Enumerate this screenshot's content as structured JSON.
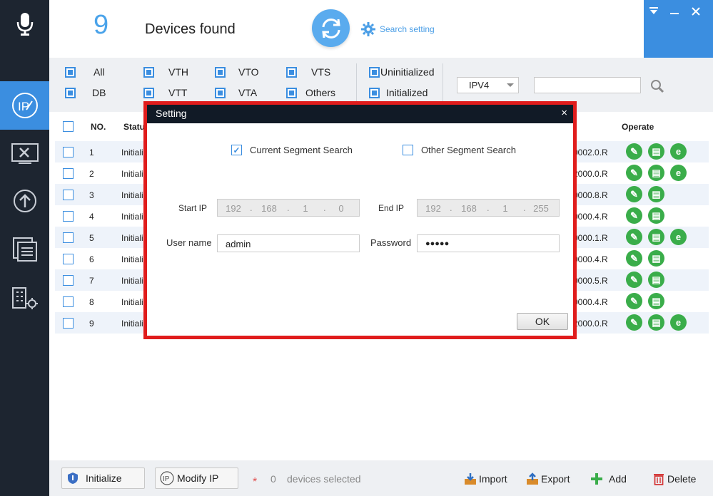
{
  "header": {
    "device_count": "9",
    "devices_found_label": "Devices found",
    "search_setting_label": "Search setting"
  },
  "filters": {
    "row1": [
      "All",
      "VTH",
      "VTO",
      "VTS"
    ],
    "row2": [
      "DB",
      "VTT",
      "VTA",
      "Others"
    ],
    "uninitialized": "Uninitialized",
    "initialized": "Initialized",
    "ip_version": "IPV4",
    "search_value": ""
  },
  "table": {
    "columns": {
      "no": "NO.",
      "status": "Statu",
      "operate": "Operate"
    },
    "rows": [
      {
        "no": "1",
        "status": "Initiali",
        "version": "0002.0.R",
        "ops": 3
      },
      {
        "no": "2",
        "status": "Initiali",
        "version": "2000.0.R",
        "ops": 3
      },
      {
        "no": "3",
        "status": "Initiali",
        "version": "0000.8.R",
        "ops": 2
      },
      {
        "no": "4",
        "status": "Initiali",
        "version": "0000.4.R",
        "ops": 2
      },
      {
        "no": "5",
        "status": "Initiali",
        "version": "0000.1.R",
        "ops": 3
      },
      {
        "no": "6",
        "status": "Initiali",
        "version": "0000.4.R",
        "ops": 2
      },
      {
        "no": "7",
        "status": "Initiali",
        "version": "0000.5.R",
        "ops": 2
      },
      {
        "no": "8",
        "status": "Initiali",
        "version": "0000.4.R",
        "ops": 2
      },
      {
        "no": "9",
        "status": "Initiali",
        "version": "2000.0.R",
        "ops": 3
      }
    ]
  },
  "dialog": {
    "title": "Setting",
    "close": "×",
    "current_segment": "Current Segment Search",
    "other_segment": "Other Segment Search",
    "start_ip_label": "Start IP",
    "start_ip": [
      "192",
      "168",
      "1",
      "0"
    ],
    "end_ip_label": "End IP",
    "end_ip": [
      "192",
      "168",
      "1",
      "255"
    ],
    "username_label": "User name",
    "username": "admin",
    "password_label": "Password",
    "password": "●●●●●",
    "ok": "OK"
  },
  "footer": {
    "initialize": "Initialize",
    "modify_ip": "Modify IP",
    "asterisk": "*",
    "selected_count": "0",
    "selected_label": "devices selected",
    "import": "Import",
    "export": "Export",
    "add": "Add",
    "delete": "Delete"
  },
  "colors": {
    "accent": "#3b8ee0",
    "sidebar": "#1d2530",
    "highlight_frame": "#e01c1c",
    "op_green": "#3aad4a"
  }
}
